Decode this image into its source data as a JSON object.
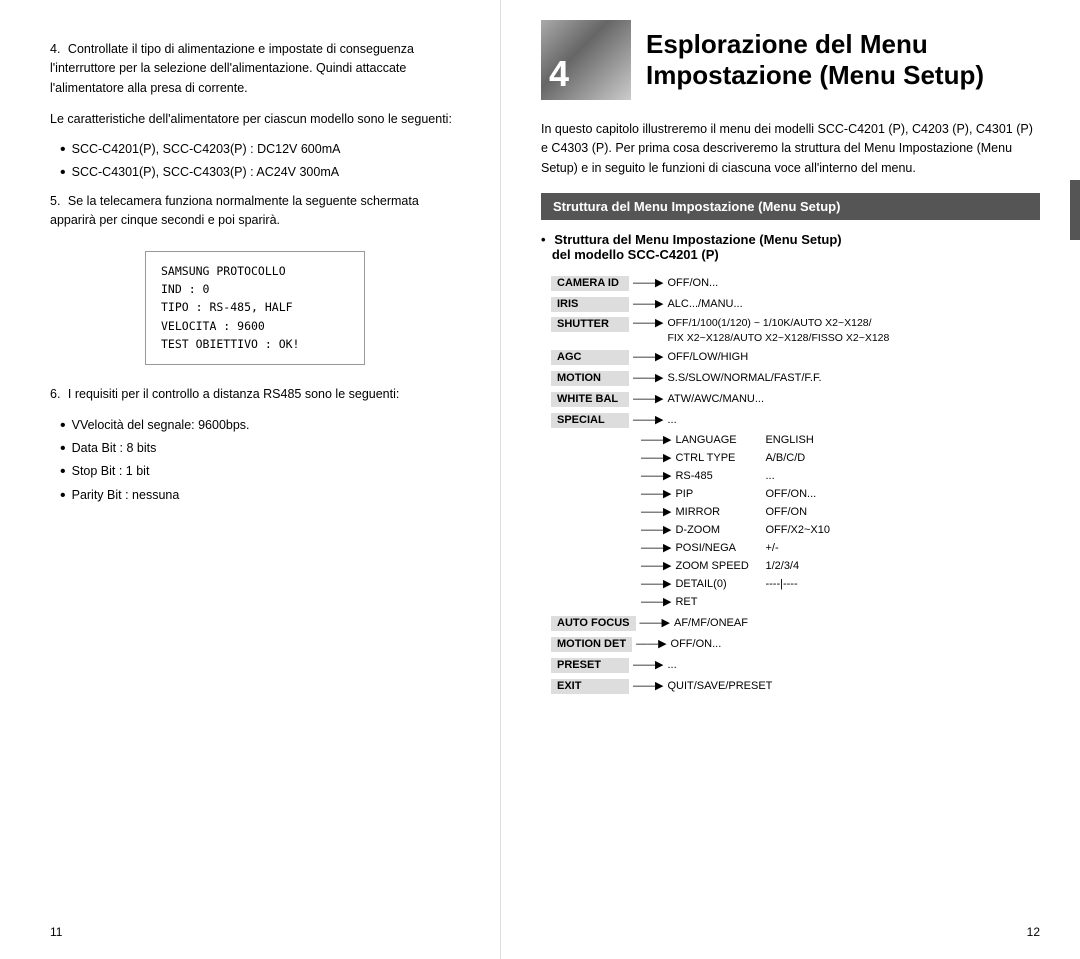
{
  "left_page": {
    "page_number": "11",
    "numbered_items": [
      {
        "num": "4.",
        "text": "Controllate il tipo di alimentazione e impostate di conseguenza l'interruttore per la selezione dell'alimentazione. Quindi attaccate l'alimentatore alla presa di corrente."
      }
    ],
    "para1": "Le caratteristiche dell'alimentatore per ciascun modello sono le seguenti:",
    "bullets1": [
      "SCC-C4201(P), SCC-C4203(P) : DC12V 600mA",
      "SCC-C4301(P), SCC-C4303(P) : AC24V 300mA"
    ],
    "item5": {
      "num": "5.",
      "text": "Se la telecamera funziona normalmente la seguente schermata apparirà per cinque secondi e poi sparirà."
    },
    "screen_lines": [
      "SAMSUNG PROTOCOLLO",
      "IND : 0",
      "TIPO : RS-485, HALF",
      "VELOCITA : 9600",
      "TEST OBIETTIVO : OK!"
    ],
    "item6": {
      "num": "6.",
      "text": "I requisiti per il controllo a distanza RS485 sono le seguenti:"
    },
    "bullets2": [
      "VVelocità del segnale: 9600bps.",
      "Data Bit : 8 bits",
      "Stop Bit : 1 bit",
      "Parity Bit : nessuna"
    ]
  },
  "right_page": {
    "page_number": "12",
    "chapter_num": "4",
    "chapter_title_line1": "Esplorazione del Menu",
    "chapter_title_line2": "Impostazione (Menu Setup)",
    "intro_text": "In questo capitolo illustreremo il menu dei modelli SCC-C4201 (P), C4203 (P), C4301 (P) e C4303 (P). Per prima cosa descriveremo la struttura del Menu Impostazione (Menu Setup) e in seguito le funzioni di ciascuna voce all'interno del menu.",
    "section_header": "Struttura del Menu Impostazione (Menu Setup)",
    "menu_subtitle_line1": "Struttura del Menu Impostazione (Menu Setup)",
    "menu_subtitle_line2": "del modello SCC-C4201 (P)",
    "menu_items": [
      {
        "label": "CAMERA ID",
        "arrow": true,
        "value": "OFF/ON..."
      },
      {
        "label": "IRIS",
        "arrow": true,
        "value": "ALC.../MANU..."
      },
      {
        "label": "SHUTTER",
        "arrow": true,
        "value": "OFF/1/100(1/120) ~ 1/10K/AUTO X2~X128/ FIX X2~X128/AUTO X2~X128/FISSO X2~X128"
      },
      {
        "label": "AGC",
        "arrow": true,
        "value": "OFF/LOW/HIGH"
      },
      {
        "label": "MOTION",
        "arrow": true,
        "value": "S.S/SLOW/NORMAL/FAST/F.F."
      },
      {
        "label": "WHITE BAL",
        "arrow": true,
        "value": "ATW/AWC/MANU..."
      },
      {
        "label": "SPECIAL",
        "arrow": true,
        "value": "..."
      }
    ],
    "special_sub": [
      {
        "label": "LANGUAGE",
        "value": "ENGLISH"
      },
      {
        "label": "CTRL TYPE",
        "value": "A/B/C/D"
      },
      {
        "label": "RS-485",
        "value": "..."
      },
      {
        "label": "PIP",
        "value": "OFF/ON..."
      },
      {
        "label": "MIRROR",
        "value": "OFF/ON"
      },
      {
        "label": "D-ZOOM",
        "value": "OFF/X2~X10"
      },
      {
        "label": "POSI/NEGA",
        "value": "+/-"
      },
      {
        "label": "ZOOM SPEED",
        "value": "1/2/3/4"
      },
      {
        "label": "DETAIL(0)",
        "value": "----|----"
      },
      {
        "label": "RET",
        "value": ""
      }
    ],
    "bottom_menu_items": [
      {
        "label": "AUTO FOCUS",
        "arrow": true,
        "value": "AF/MF/ONEAF"
      },
      {
        "label": "MOTION DET",
        "arrow": true,
        "value": "OFF/ON..."
      },
      {
        "label": "PRESET",
        "arrow": true,
        "value": "..."
      },
      {
        "label": "EXIT",
        "arrow": true,
        "value": "QUIT/SAVE/PRESET"
      }
    ]
  }
}
